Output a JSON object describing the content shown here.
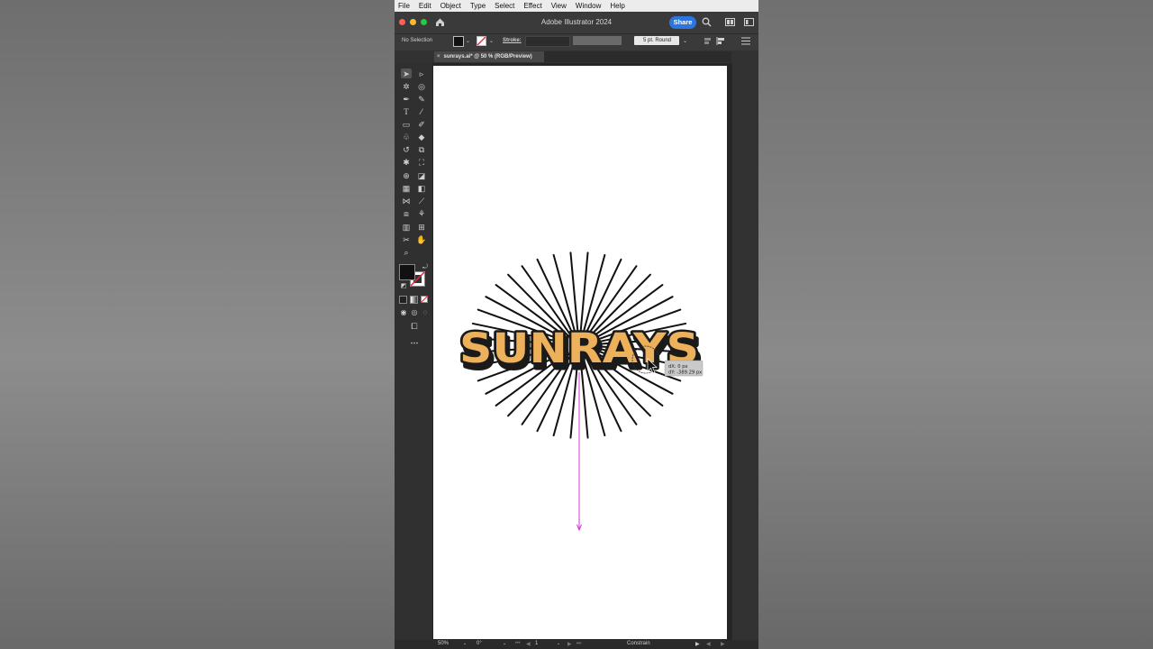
{
  "menubar": {
    "items": [
      "File",
      "Edit",
      "Object",
      "Type",
      "Select",
      "Effect",
      "View",
      "Window",
      "Help"
    ]
  },
  "titlebar": {
    "app_title": "Adobe Illustrator 2024",
    "share_label": "Share"
  },
  "controlbar": {
    "selection_status": "No Selection",
    "stroke_label": "Stroke:",
    "brush_label": "5 pt. Round"
  },
  "document": {
    "tab_title": "sunrays.ai* @ 50 % (RGB/Preview)",
    "close_glyph": "×"
  },
  "artwork": {
    "word": "SUNRAYS",
    "fill_color": "#EDB15B",
    "shadow_color": "#1a1a1a",
    "ray_color": "#111111",
    "guide_color": "#d13ad1",
    "ray_count": 40
  },
  "tooltip": {
    "dx": "dX: 0 px",
    "dy": "dY: -389.29 px"
  },
  "statusbar": {
    "zoom": "50%",
    "rotation": "0°",
    "artboard_number": "1",
    "tool_status": "Constrain"
  },
  "icons": {
    "tools": [
      "selection-icon",
      "direct-selection-icon",
      "magic-wand-icon",
      "lasso-icon",
      "pen-icon",
      "curvature-icon",
      "type-icon",
      "line-icon",
      "rectangle-icon",
      "paintbrush-icon",
      "shaper-icon",
      "eraser-icon",
      "rotate-icon",
      "scale-icon",
      "puppet-warp-icon",
      "free-transform-icon",
      "shape-builder-icon",
      "live-paint-icon",
      "perspective-icon",
      "gradient-icon",
      "mesh-icon",
      "eyedropper-icon",
      "blend-icon",
      "symbol-sprayer-icon",
      "graph-icon",
      "artboard-icon",
      "slice-icon",
      "hand-icon",
      "zoom-icon"
    ],
    "right_panel": [
      "properties-icon",
      "libraries-icon",
      "symbols-icon",
      "stroke-panel-icon",
      "gradient-panel-icon",
      "transparency-icon",
      "appearance-icon",
      "layers-icon",
      "export-icon",
      "artboards-panel-icon",
      "asset-export-icon",
      "align-icon",
      "transform-icon",
      "pathfinder-icon",
      "color-guide-icon",
      "brushes-icon",
      "character-icon",
      "paragraph-icon",
      "opentype-icon"
    ]
  }
}
